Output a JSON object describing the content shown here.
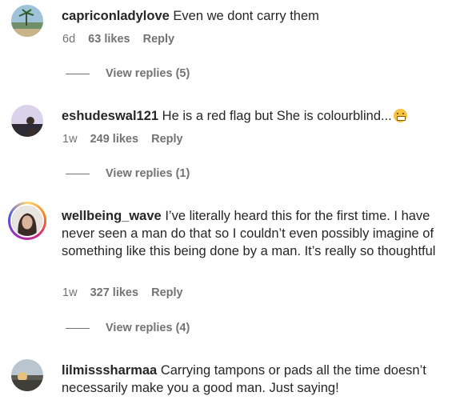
{
  "comments": [
    {
      "username": "capriconladylove",
      "text": "Even we dont carry them",
      "time": "6d",
      "likes": "63 likes",
      "reply": "Reply",
      "view_replies": "View replies (5)"
    },
    {
      "username": "eshudeswal121",
      "text": "He is a red flag but She is colourblind...",
      "time": "1w",
      "likes": "249 likes",
      "reply": "Reply",
      "view_replies": "View replies (1)"
    },
    {
      "username": "wellbeing_wave",
      "text": "I’ve literally heard this for the first time. I have never seen a man do that so I couldn’t even possibly imagine of something like this being done by a man. It’s really so thoughtful",
      "time": "1w",
      "likes": "327 likes",
      "reply": "Reply",
      "view_replies": "View replies (4)"
    },
    {
      "username": "lilmisssharmaa",
      "text": "Carrying tampons or pads all the time doesn’t necessarily make you a good man. Just saying!",
      "time": "",
      "likes": "",
      "reply": "",
      "view_replies": ""
    }
  ]
}
